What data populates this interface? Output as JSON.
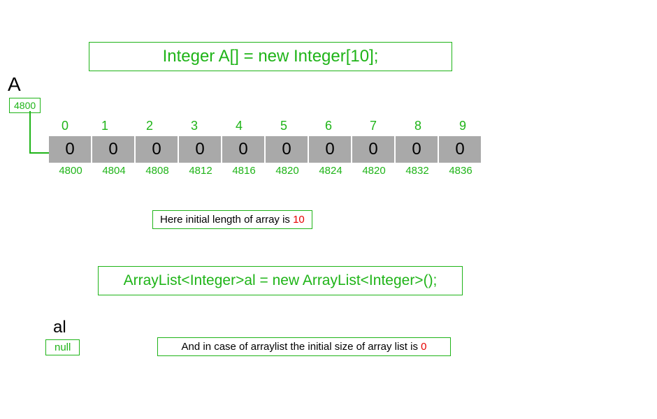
{
  "topCode": "Integer A[] = new Integer[10];",
  "varA": "A",
  "pointerA": "4800",
  "cells": [
    {
      "index": "0",
      "value": "0",
      "address": "4800"
    },
    {
      "index": "1",
      "value": "0",
      "address": "4804"
    },
    {
      "index": "2",
      "value": "0",
      "address": "4808"
    },
    {
      "index": "3",
      "value": "0",
      "address": "4812"
    },
    {
      "index": "4",
      "value": "0",
      "address": "4816"
    },
    {
      "index": "5",
      "value": "0",
      "address": "4820"
    },
    {
      "index": "6",
      "value": "0",
      "address": "4824"
    },
    {
      "index": "7",
      "value": "0",
      "address": "4820"
    },
    {
      "index": "8",
      "value": "0",
      "address": "4832"
    },
    {
      "index": "9",
      "value": "0",
      "address": "4836"
    }
  ],
  "note1_text": "Here initial length of array  is ",
  "note1_num": "10",
  "bottomCode": "ArrayList<Integer>al = new ArrayList<Integer>();",
  "varAl": "al",
  "alValue": "null",
  "note2_text": "And in case of arraylist the initial size of array list is ",
  "note2_num": "0",
  "chart_data": {
    "type": "table",
    "title": "Integer array vs ArrayList initial state",
    "array": {
      "name": "A",
      "declaration": "Integer A[] = new Integer[10];",
      "base_address": 4800,
      "length": 10,
      "indices": [
        0,
        1,
        2,
        3,
        4,
        5,
        6,
        7,
        8,
        9
      ],
      "values": [
        0,
        0,
        0,
        0,
        0,
        0,
        0,
        0,
        0,
        0
      ],
      "addresses": [
        4800,
        4804,
        4808,
        4812,
        4816,
        4820,
        4824,
        4820,
        4832,
        4836
      ]
    },
    "arraylist": {
      "name": "al",
      "declaration": "ArrayList<Integer>al = new ArrayList<Integer>();",
      "value": "null",
      "initial_size": 0
    }
  }
}
